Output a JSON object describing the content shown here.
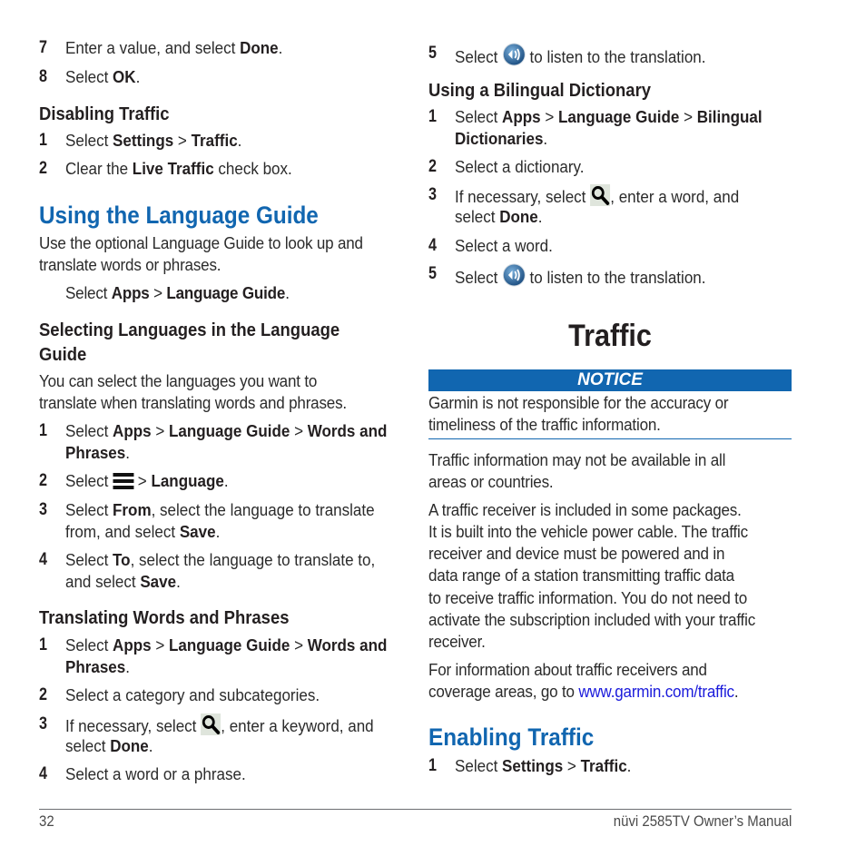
{
  "left_column": {
    "top_steps": [
      {
        "num": "7",
        "pre": "Enter a value, and select ",
        "bold": "Done",
        "post": "."
      },
      {
        "num": "8",
        "pre": "Select ",
        "bold": "OK",
        "post": "."
      }
    ],
    "disabling_traffic": {
      "heading": "Disabling Traffic",
      "steps": [
        {
          "num": "1",
          "pre": "Select ",
          "b1": "Settings",
          "sep": " > ",
          "b2": "Traffic",
          "post": "."
        },
        {
          "num": "2",
          "pre": "Clear the ",
          "b1": "Live Traffic",
          "post": " check box."
        }
      ]
    },
    "language_guide": {
      "heading": "Using the Language Guide",
      "intro_line1": "Use the optional Language Guide to look up and",
      "intro_line2": "translate words or phrases.",
      "select_pre": "Select ",
      "select_b1": "Apps",
      "select_sep": " > ",
      "select_b2": "Language Guide",
      "select_post": "."
    },
    "selecting_languages": {
      "heading_line1": "Selecting Languages in the Language",
      "heading_line2": "Guide",
      "intro_line1": "You can select the languages you want to",
      "intro_line2": "translate when translating words and phrases.",
      "steps": [
        {
          "num": "1",
          "pre": "Select ",
          "b1": "Apps",
          "sep1": " > ",
          "b2": "Language Guide",
          "sep2": " > ",
          "b3": "Words and",
          "line2_bold": "Phrases",
          "line2_post": "."
        },
        {
          "num": "2",
          "pre": "Select ",
          "icon": "menu-icon",
          "sep": " > ",
          "b1": "Language",
          "post": "."
        },
        {
          "num": "3",
          "pre": "Select ",
          "b1": "From",
          "post": ", select the language to translate",
          "line2_pre": "from, and select ",
          "line2_bold": "Save",
          "line2_post": "."
        },
        {
          "num": "4",
          "pre": "Select ",
          "b1": "To",
          "post": ", select the language to translate to,",
          "line2_pre": "and select ",
          "line2_bold": "Save",
          "line2_post": "."
        }
      ]
    },
    "translating_words": {
      "heading": "Translating Words and Phrases",
      "steps": [
        {
          "num": "1",
          "pre": "Select ",
          "b1": "Apps",
          "sep1": " > ",
          "b2": "Language Guide",
          "sep2": " > ",
          "b3": "Words and",
          "line2_bold": "Phrases",
          "line2_post": "."
        },
        {
          "num": "2",
          "text": "Select a category and subcategories."
        },
        {
          "num": "3",
          "pre": "If necessary, select ",
          "icon": "search-icon",
          "post": ", enter a keyword, and",
          "line2_pre": "select ",
          "line2_bold": "Done",
          "line2_post": "."
        },
        {
          "num": "4",
          "text": "Select a word or a phrase."
        }
      ]
    }
  },
  "right_column": {
    "top_step": {
      "num": "5",
      "pre": "Select ",
      "icon": "speaker-icon",
      "post": " to listen to the translation."
    },
    "bilingual_dictionary": {
      "heading": "Using a Bilingual Dictionary",
      "steps": [
        {
          "num": "1",
          "pre": "Select ",
          "b1": "Apps",
          "sep1": " > ",
          "b2": "Language Guide",
          "sep2": " > ",
          "b3": "Bilingual",
          "line2_bold": "Dictionaries",
          "line2_post": "."
        },
        {
          "num": "2",
          "text": "Select a dictionary."
        },
        {
          "num": "3",
          "pre": "If necessary, select ",
          "icon": "search-icon",
          "post": ", enter a word, and",
          "line2_pre": "select ",
          "line2_bold": "Done",
          "line2_post": "."
        },
        {
          "num": "4",
          "text": "Select a word."
        },
        {
          "num": "5",
          "pre": "Select ",
          "icon": "speaker-icon",
          "post": " to listen to the translation."
        }
      ]
    },
    "traffic": {
      "title": "Traffic",
      "notice_label": "NOTICE",
      "notice_line1": "Garmin is not responsible for the accuracy or",
      "notice_line2": "timeliness of the traffic information.",
      "para1_line1": "Traffic information may not be available in all",
      "para1_line2": "areas or countries.",
      "para2_lines": [
        "A traffic receiver is included in some packages.",
        "It is built into the vehicle power cable. The traffic",
        "receiver and device must be powered and in",
        "data range of a station transmitting traffic data",
        "to receive traffic information. You do not need to",
        "activate the subscription included with your traffic",
        "receiver."
      ],
      "para3_line1": "For information about traffic receivers and",
      "para3_line2_pre": "coverage areas, go to ",
      "para3_link": "www.garmin.com/traffic",
      "para3_line2_post": "."
    },
    "enabling_traffic": {
      "heading": "Enabling Traffic",
      "steps": [
        {
          "num": "1",
          "pre": "Select ",
          "b1": "Settings",
          "sep": " > ",
          "b2": "Traffic",
          "post": "."
        }
      ]
    }
  },
  "footer": {
    "page_number": "32",
    "manual_title": "nüvi 2585TV Owner’s Manual"
  },
  "colors": {
    "heading_blue": "#1166b0",
    "link_blue": "#1a1adb",
    "text": "#231f20"
  }
}
